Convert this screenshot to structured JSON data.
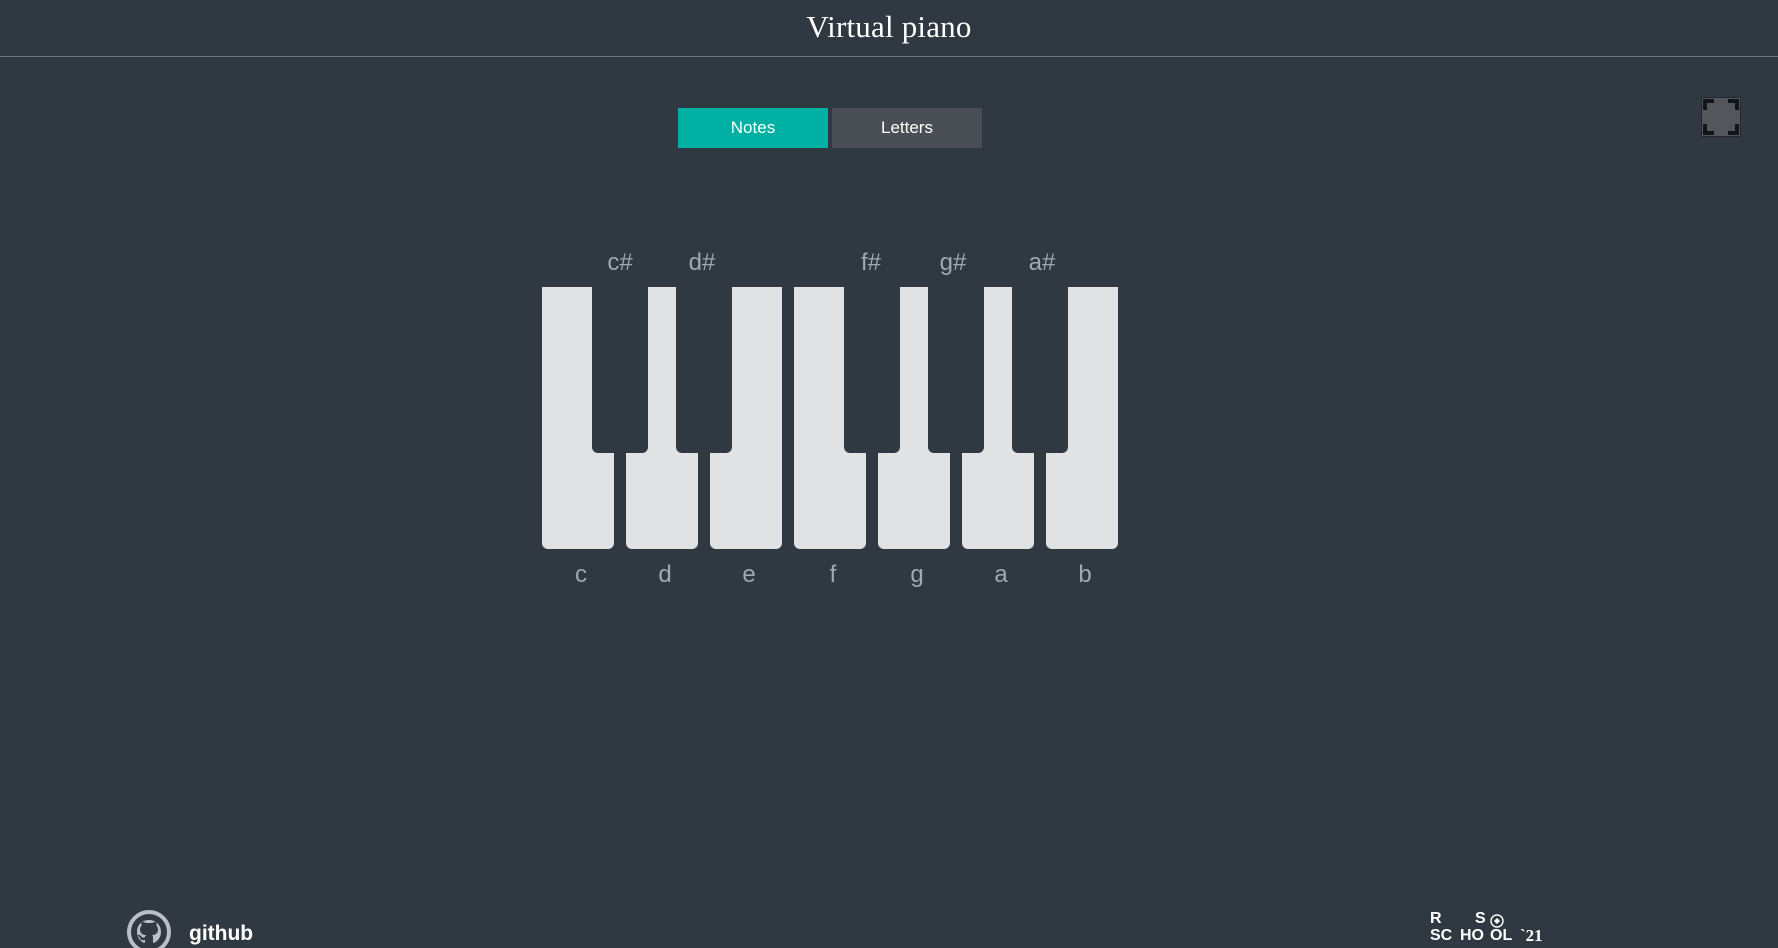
{
  "header": {
    "title": "Virtual piano"
  },
  "controls": {
    "notes_label": "Notes",
    "letters_label": "Letters",
    "active": "Notes",
    "accent_color": "#00b0a2"
  },
  "fullscreen": {
    "icon": "fullscreen-icon"
  },
  "piano": {
    "white_keys": [
      "c",
      "d",
      "e",
      "f",
      "g",
      "a",
      "b"
    ],
    "sharp_keys": [
      "c#",
      "d#",
      "f#",
      "g#",
      "a#"
    ]
  },
  "footer": {
    "github_label": "github",
    "github_icon": "github-icon",
    "school_logo": "rs-school-logo",
    "school_year": "`21"
  },
  "colors": {
    "background": "#303841",
    "white_key": "#e1e2e4",
    "label": "#a0a8b0"
  }
}
